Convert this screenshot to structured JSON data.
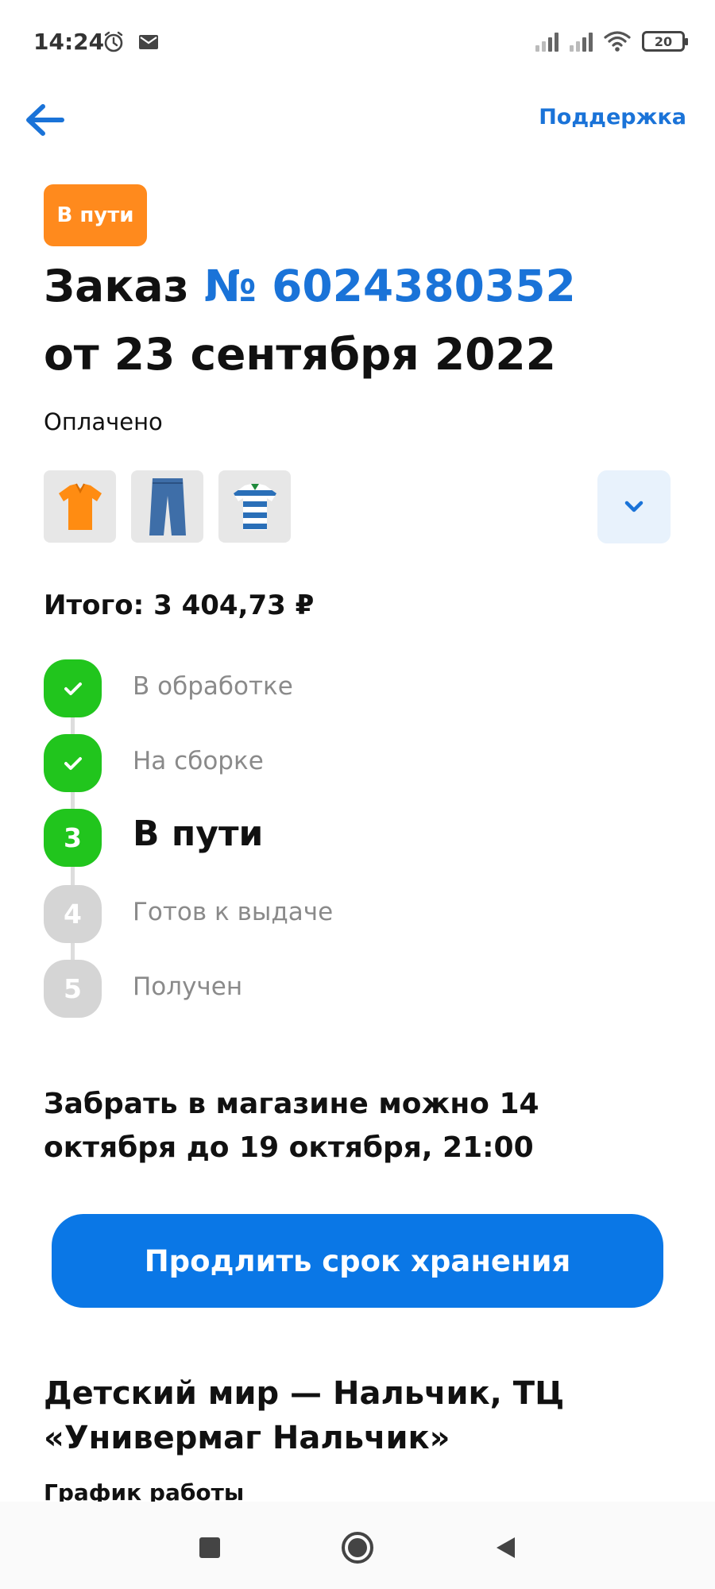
{
  "status_bar": {
    "time": "14:24",
    "battery": "20"
  },
  "header": {
    "support_label": "Поддержка"
  },
  "order": {
    "status_badge": "В пути",
    "title_prefix": "Заказ",
    "number": "№ 6024380352",
    "date_line": "от 23 сентября 2022",
    "payment_status": "Оплачено",
    "total": "Итого: 3 404,73 ₽",
    "items": [
      {
        "icon": "orange-polo-shirt"
      },
      {
        "icon": "blue-jeans"
      },
      {
        "icon": "striped-polo-shirt"
      }
    ]
  },
  "steps": [
    {
      "marker": "",
      "label": "В обработке",
      "state": "done"
    },
    {
      "marker": "",
      "label": "На сборке",
      "state": "done"
    },
    {
      "marker": "3",
      "label": "В пути",
      "state": "current"
    },
    {
      "marker": "4",
      "label": "Готов к выдаче",
      "state": "todo"
    },
    {
      "marker": "5",
      "label": "Получен",
      "state": "todo"
    }
  ],
  "pickup": {
    "text": "Забрать в магазине можно 14 октября до 19 октября, 21:00",
    "extend_button": "Продлить срок хранения"
  },
  "store": {
    "name": "Детский мир — Нальчик, ТЦ «Универмаг Нальчик»",
    "hours_label": "График работы"
  },
  "colors": {
    "accent": "#1a73d8",
    "badge": "#ff8a1d",
    "success": "#21c51d",
    "button": "#0a77e6"
  }
}
